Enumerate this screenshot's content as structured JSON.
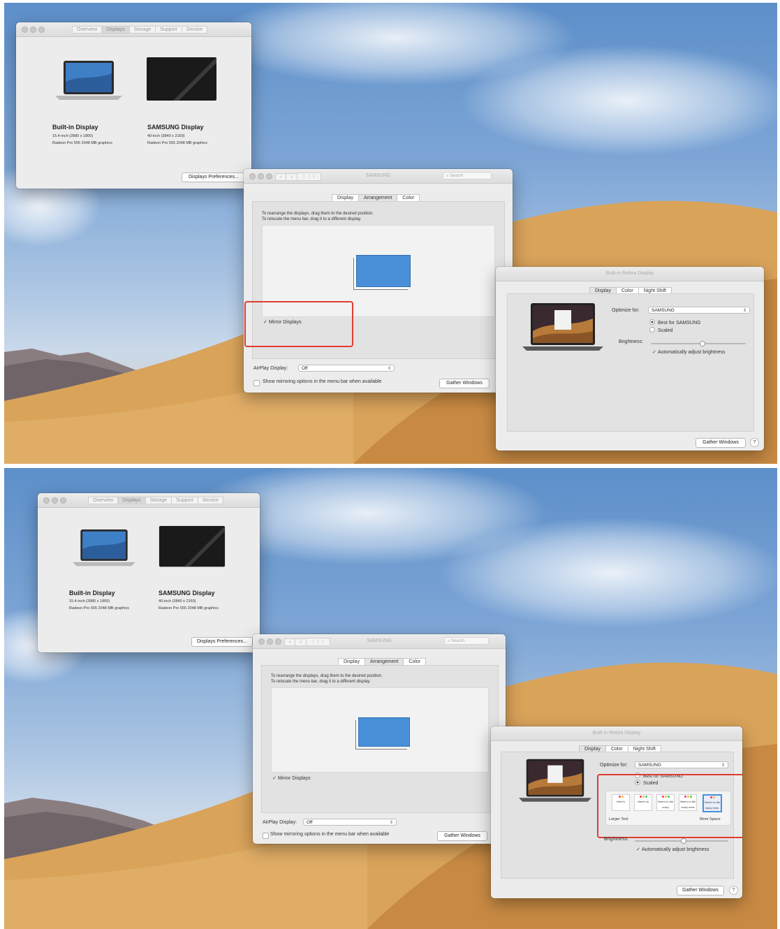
{
  "colors": {
    "highlight": "#e03c31",
    "arrangement_display": "#4a90d9",
    "window_bg": "#ececec"
  },
  "panels": [
    {
      "about": {
        "tabs": [
          "Overview",
          "Displays",
          "Storage",
          "Support",
          "Service"
        ],
        "displays": [
          {
            "name": "Built-in Display",
            "size": "15.4-inch (2880 x 1800)",
            "graphics": "Radeon Pro 555 2048 MB graphics"
          },
          {
            "name": "SAMSUNG Display",
            "size": "40-inch (3840 x 2160)",
            "graphics": "Radeon Pro 555 2048 MB graphics"
          }
        ],
        "prefs_button": "Displays Preferences..."
      },
      "samsung": {
        "title": "SAMSUNG",
        "search_placeholder": "Search",
        "tabs": [
          "Display",
          "Arrangement",
          "Color"
        ],
        "instructions": [
          "To rearrange the displays, drag them to the desired position.",
          "To relocate the menu bar, drag it to a different display."
        ],
        "mirror_label": "Mirror Displays",
        "airplay_label": "AirPlay Display:",
        "airplay_value": "Off",
        "show_mirroring_label": "Show mirroring options in the menu bar when available",
        "gather_button": "Gather Windows"
      },
      "builtin": {
        "title": "Built-in Retina Display",
        "tabs": [
          "Display",
          "Color",
          "Night Shift"
        ],
        "optimize_label": "Optimize for:",
        "optimize_value": "SAMSUNG",
        "best_label": "Best for SAMSUNG",
        "scaled_label": "Scaled",
        "brightness_label": "Brightness:",
        "auto_brightness_label": "Automatically adjust brightness",
        "gather_button": "Gather Windows",
        "help": "?"
      }
    },
    {
      "about": {
        "tabs": [
          "Overview",
          "Displays",
          "Storage",
          "Support",
          "Service"
        ],
        "displays": [
          {
            "name": "Built-in Display",
            "size": "15.4-inch (2880 x 1800)",
            "graphics": "Radeon Pro 555 2048 MB graphics"
          },
          {
            "name": "SAMSUNG Display",
            "size": "40-inch (3840 x 2160)",
            "graphics": "Radeon Pro 555 2048 MB graphics"
          }
        ],
        "prefs_button": "Displays Preferences..."
      },
      "samsung": {
        "title": "SAMSUNG",
        "search_placeholder": "Search",
        "tabs": [
          "Display",
          "Arrangement",
          "Color"
        ],
        "instructions": [
          "To rearrange the displays, drag them to the desired position.",
          "To relocate the menu bar, drag it to a different display."
        ],
        "mirror_label": "Mirror Displays",
        "airplay_label": "AirPlay Display:",
        "airplay_value": "Off",
        "show_mirroring_label": "Show mirroring options in the menu bar when available",
        "gather_button": "Gather Windows"
      },
      "builtin": {
        "title": "Built-in Retina Display",
        "tabs": [
          "Display",
          "Color",
          "Night Shift"
        ],
        "optimize_label": "Optimize for:",
        "optimize_value": "SAMSUNG",
        "best_label": "Best for SAMSUNG",
        "scaled_label": "Scaled",
        "resolution_thumbs": [
          "Here's",
          "Here's to",
          "Here's to the crazy",
          "Here's to the crazy ones",
          "Here's to the crazy ones. The misfits."
        ],
        "larger_text_label": "Larger Text",
        "more_space_label": "More Space",
        "brightness_label": "Brightness:",
        "auto_brightness_label": "Automatically adjust brightness",
        "gather_button": "Gather Windows",
        "help": "?"
      }
    }
  ]
}
